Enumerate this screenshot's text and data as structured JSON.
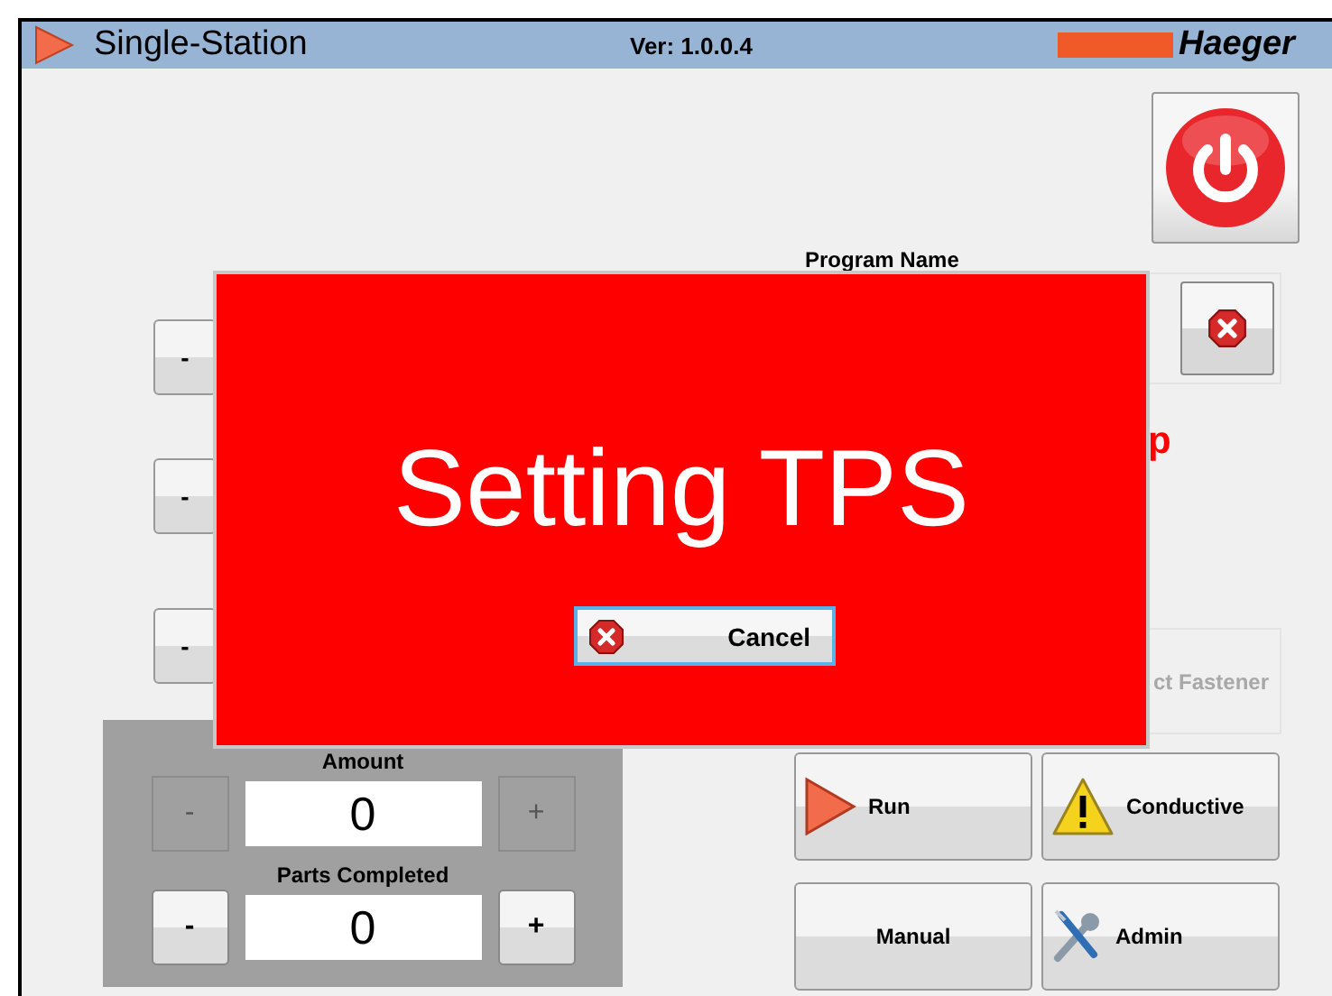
{
  "title_bar": {
    "title": "Single-Station",
    "version": "Ver: 1.0.0.4",
    "logo_text": "Haeger"
  },
  "adjust_buttons": [
    {
      "label": "-"
    },
    {
      "label": "-"
    },
    {
      "label": "-"
    }
  ],
  "program": {
    "label": "Program Name"
  },
  "status_text": "p",
  "fastener_button": {
    "label": "ct Fastener",
    "disabled": true
  },
  "counters": [
    {
      "label": "Amount",
      "value": "0",
      "minus": "-",
      "plus": "+",
      "disabled": true
    },
    {
      "label": "Parts Completed",
      "value": "0",
      "minus": "-",
      "plus": "+",
      "disabled": false
    }
  ],
  "action_buttons": [
    {
      "label": "Run",
      "kind": "run"
    },
    {
      "label": "Conductive",
      "kind": "conductive"
    },
    {
      "label": "Manual",
      "kind": "manual"
    },
    {
      "label": "Admin",
      "kind": "admin"
    }
  ],
  "dialog": {
    "message": "Setting TPS",
    "button": "Cancel"
  }
}
